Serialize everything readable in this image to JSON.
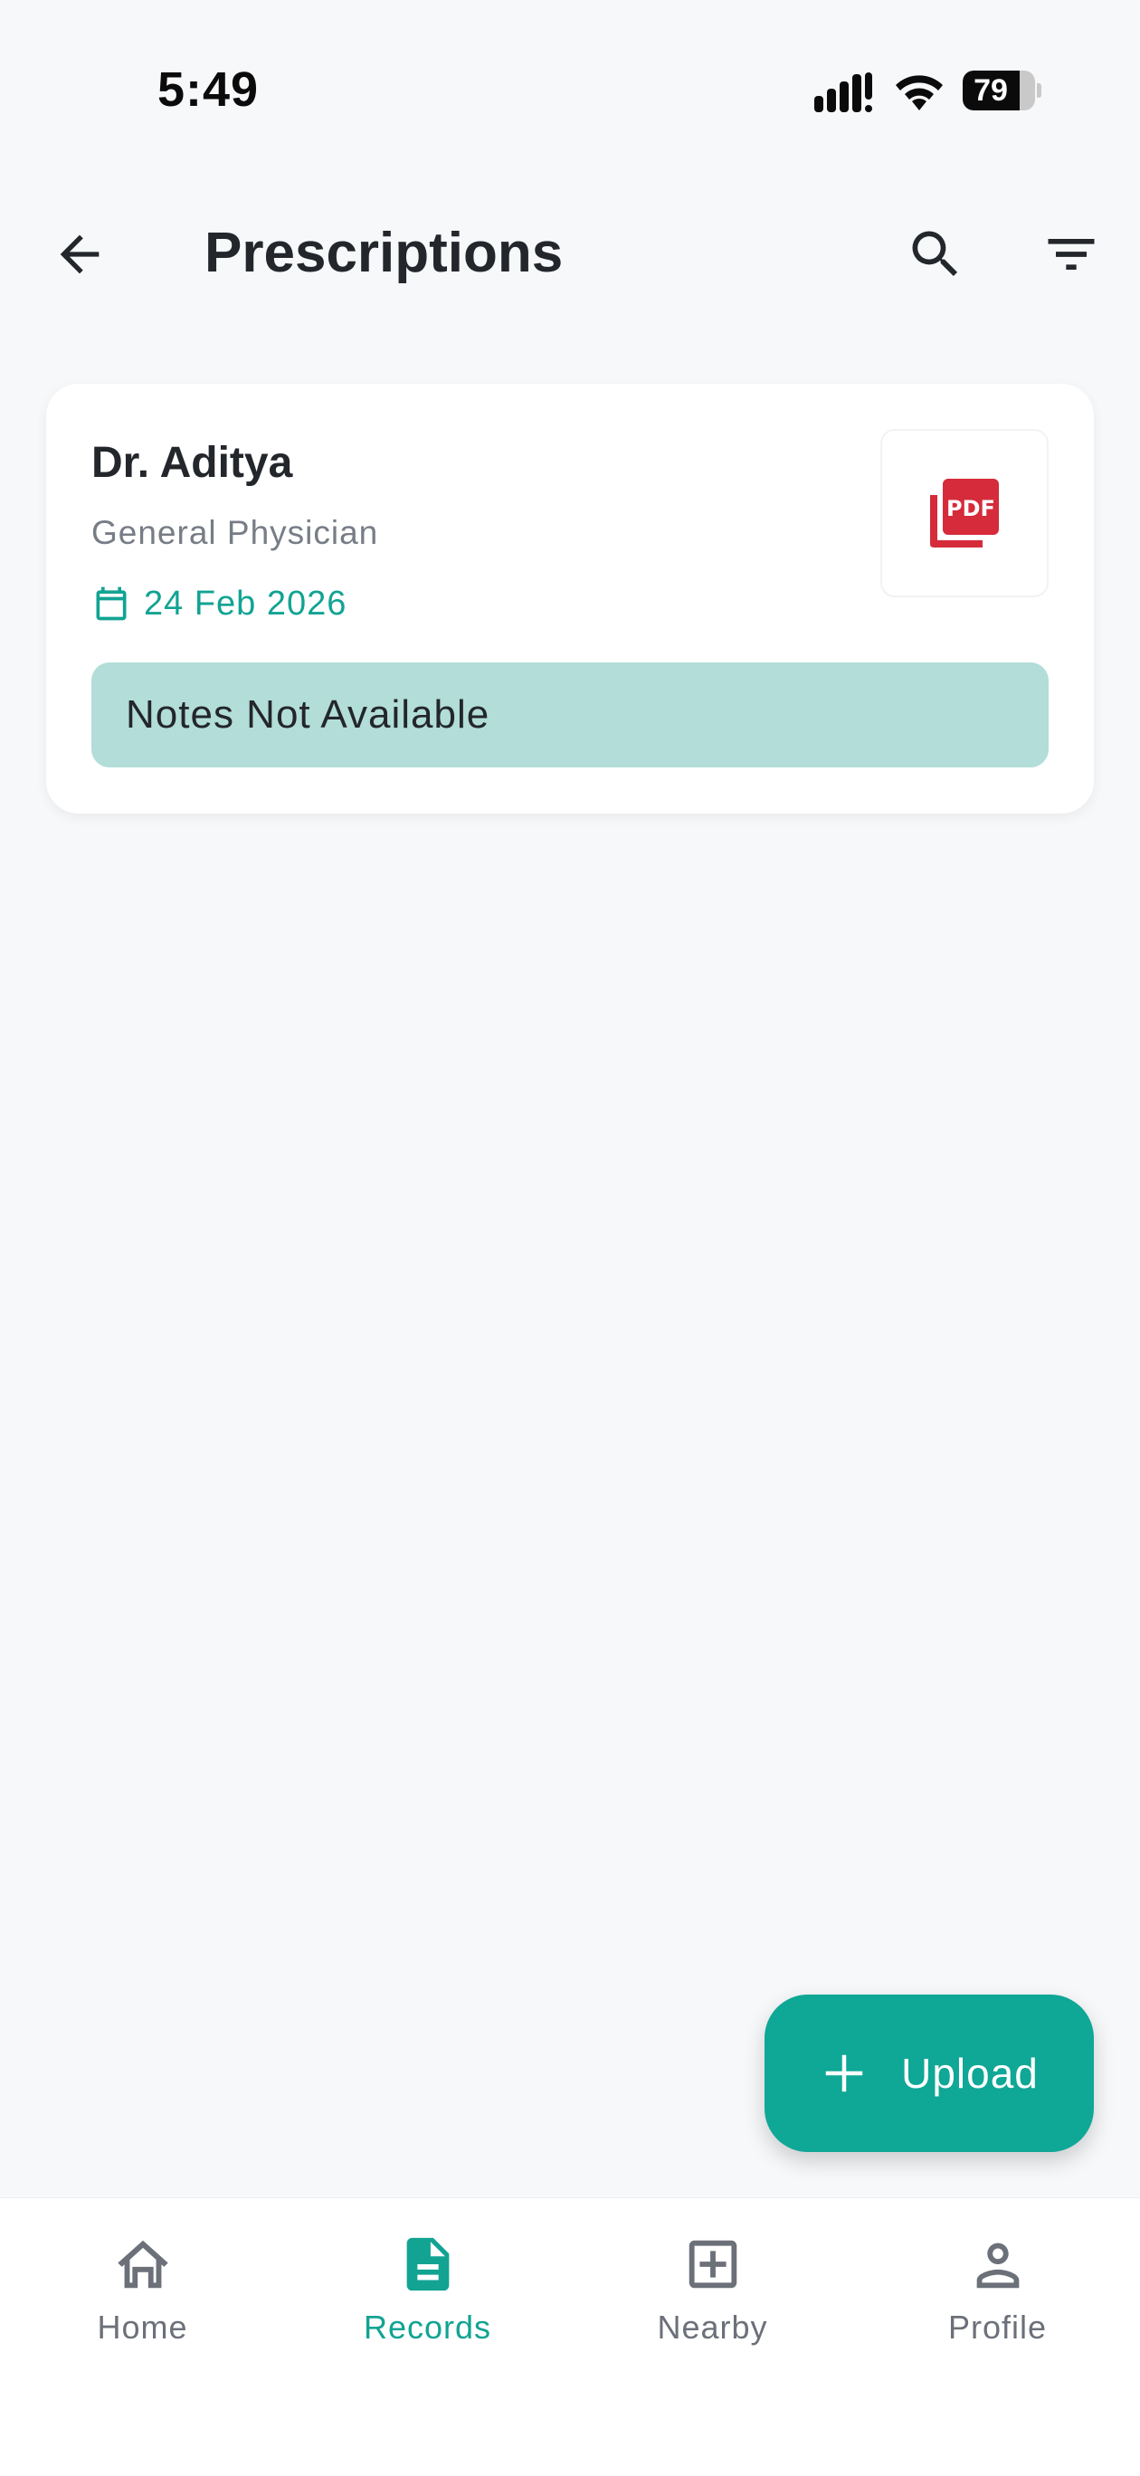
{
  "status_bar": {
    "time": "5:49",
    "battery_level": "79",
    "icons": [
      "signal-icon",
      "wifi-icon",
      "battery-icon"
    ]
  },
  "header": {
    "title": "Prescriptions",
    "icons": [
      "back-arrow-icon",
      "search-icon",
      "filter-icon"
    ]
  },
  "prescription_card": {
    "doctor_name": "Dr. Aditya",
    "specialty": "General Physician",
    "date": "24 Feb 2026",
    "attachment_icon": "pdf-icon",
    "notes": "Notes Not Available"
  },
  "fab": {
    "label": "Upload",
    "icon": "plus-icon"
  },
  "bottom_nav": {
    "items": [
      {
        "label": "Home",
        "icon": "home-icon",
        "active": false
      },
      {
        "label": "Records",
        "icon": "document-icon",
        "active": true
      },
      {
        "label": "Nearby",
        "icon": "medical-plus-icon",
        "active": false
      },
      {
        "label": "Profile",
        "icon": "person-icon",
        "active": false
      }
    ]
  },
  "colors": {
    "accent": "#12a393",
    "fab": "#0fa796",
    "notes_bg": "#b2ddd8",
    "pdf_red": "#d52b3a",
    "background": "#f7f8fa"
  }
}
